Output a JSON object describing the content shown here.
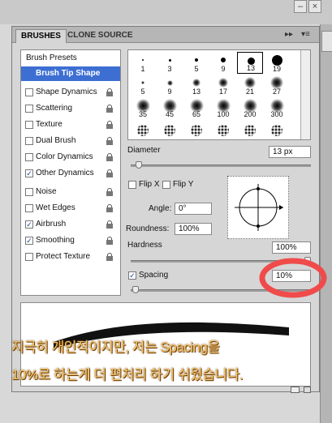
{
  "tabs": {
    "active": "BRUSHES",
    "inactive": "CLONE SOURCE"
  },
  "panel_controls": {
    "collapse": "▸▸",
    "menu": "▾≡"
  },
  "window_buttons": {
    "minimize": "–",
    "close": "×"
  },
  "brush_list": [
    {
      "label": "Brush Presets",
      "kind": "header",
      "checked": false,
      "lock": false
    },
    {
      "label": "Brush Tip Shape",
      "kind": "selected",
      "checked": false,
      "lock": false
    },
    {
      "label": "Shape Dynamics",
      "kind": "option",
      "checked": false,
      "lock": true
    },
    {
      "label": "Scattering",
      "kind": "option",
      "checked": false,
      "lock": true
    },
    {
      "label": "Texture",
      "kind": "option",
      "checked": false,
      "lock": true
    },
    {
      "label": "Dual Brush",
      "kind": "option",
      "checked": false,
      "lock": true
    },
    {
      "label": "Color Dynamics",
      "kind": "option",
      "checked": false,
      "lock": true
    },
    {
      "label": "Other Dynamics",
      "kind": "option",
      "checked": true,
      "lock": true
    },
    {
      "label": "Noise",
      "kind": "option",
      "checked": false,
      "lock": true
    },
    {
      "label": "Wet Edges",
      "kind": "option",
      "checked": false,
      "lock": true
    },
    {
      "label": "Airbrush",
      "kind": "option",
      "checked": true,
      "lock": true
    },
    {
      "label": "Smoothing",
      "kind": "option",
      "checked": true,
      "lock": true
    },
    {
      "label": "Protect Texture",
      "kind": "option",
      "checked": false,
      "lock": true
    }
  ],
  "brush_presets": [
    {
      "size": "1",
      "kind": "hard",
      "d": 2
    },
    {
      "size": "3",
      "kind": "hard",
      "d": 3
    },
    {
      "size": "5",
      "kind": "hard",
      "d": 4
    },
    {
      "size": "9",
      "kind": "hard",
      "d": 6
    },
    {
      "size": "13",
      "kind": "hard",
      "d": 9,
      "selected": true
    },
    {
      "size": "19",
      "kind": "hard",
      "d": 13
    },
    {
      "size": "5",
      "kind": "soft",
      "d": 4
    },
    {
      "size": "9",
      "kind": "soft",
      "d": 7
    },
    {
      "size": "13",
      "kind": "soft",
      "d": 10
    },
    {
      "size": "17",
      "kind": "soft",
      "d": 12
    },
    {
      "size": "21",
      "kind": "soft",
      "d": 14
    },
    {
      "size": "27",
      "kind": "soft",
      "d": 16
    },
    {
      "size": "35",
      "kind": "soft",
      "d": 17
    },
    {
      "size": "45",
      "kind": "soft",
      "d": 17
    },
    {
      "size": "65",
      "kind": "soft",
      "d": 17
    },
    {
      "size": "100",
      "kind": "soft",
      "d": 17
    },
    {
      "size": "200",
      "kind": "soft",
      "d": 17
    },
    {
      "size": "300",
      "kind": "soft",
      "d": 17
    },
    {
      "size": "",
      "kind": "spatter",
      "d": 14
    },
    {
      "size": "",
      "kind": "spatter",
      "d": 14
    },
    {
      "size": "",
      "kind": "spatter",
      "d": 14
    },
    {
      "size": "",
      "kind": "spatter",
      "d": 14
    },
    {
      "size": "",
      "kind": "spatter",
      "d": 14
    },
    {
      "size": "",
      "kind": "spatter",
      "d": 14
    }
  ],
  "diameter": {
    "label": "Diameter",
    "value": "13 px"
  },
  "flip_x": {
    "label": "Flip X",
    "checked": false
  },
  "flip_y": {
    "label": "Flip Y",
    "checked": false
  },
  "angle": {
    "label": "Angle:",
    "value": "0°"
  },
  "roundness": {
    "label": "Roundness:",
    "value": "100%"
  },
  "hardness": {
    "label": "Hardness",
    "value": "100%"
  },
  "spacing": {
    "label": "Spacing",
    "value": "10%",
    "checked": true
  },
  "annotation": {
    "line1": "지극히 개인적이지만, 저는 Spacing을",
    "line2": "10%로 하는게 더 편처리 하기 쉬웠습니다.",
    "circle_color": "#f04b4b",
    "text_color": "#f2c36b"
  },
  "colors": {
    "selection": "#3d6fd3",
    "panel": "#d6d6d6"
  }
}
